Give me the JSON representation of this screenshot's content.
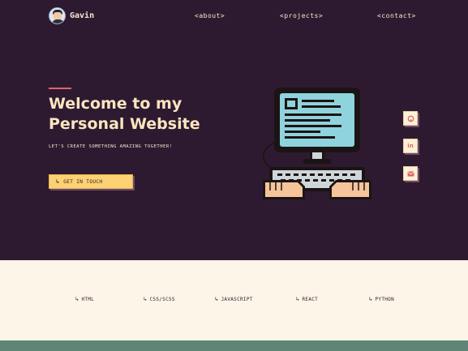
{
  "brand": {
    "name": "Gavin"
  },
  "nav": [
    {
      "label": "<about>"
    },
    {
      "label": "<projects>"
    },
    {
      "label": "<contact>"
    }
  ],
  "hero": {
    "title_line1": "Welcome to my",
    "title_line2": "Personal Website",
    "subtitle": "LET'S CREATE SOMETHING AMAZING TOGETHER!",
    "cta_label": "GET IN TOUCH"
  },
  "social": [
    {
      "icon": "github-icon"
    },
    {
      "icon": "linkedin-icon",
      "glyph": "in"
    },
    {
      "icon": "mail-icon"
    }
  ],
  "skills": [
    {
      "label": "HTML"
    },
    {
      "label": "CSS/SCSS"
    },
    {
      "label": "JAVASCRIPT"
    },
    {
      "label": "REACT"
    },
    {
      "label": "PYTHON"
    }
  ],
  "colors": {
    "background": "#2e1a30",
    "title": "#fbe5c0",
    "accent": "#e0636a",
    "button": "#fcd272",
    "skills_band": "#fdf6e8",
    "footer_band": "#5f8576"
  }
}
